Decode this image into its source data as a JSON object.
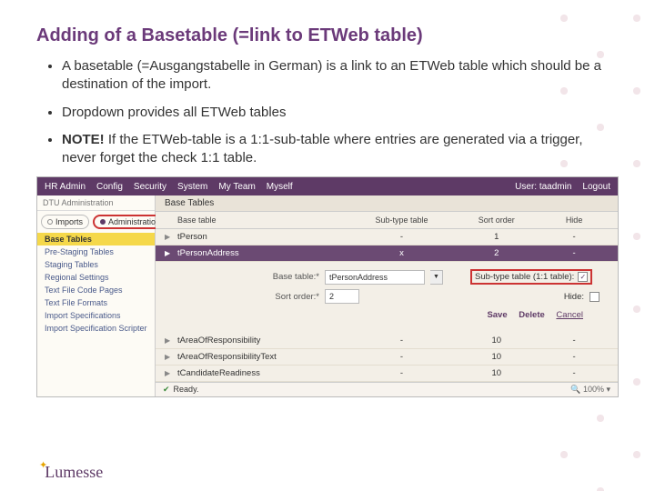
{
  "title": "Adding of a Basetable (=link to ETWeb table)",
  "bullets": {
    "b1": "A basetable (=Ausgangstabelle in German) is a link to an ETWeb table which should be a destination of the import.",
    "b2": "Dropdown provides all ETWeb tables",
    "b3_note": "NOTE!",
    "b3_rest": " If the ETWeb-table is a 1:1-sub-table where entries are generated via a trigger, never forget the check 1:1 table."
  },
  "menubar": {
    "items": [
      "HR Admin",
      "Config",
      "Security",
      "System",
      "My Team",
      "Myself"
    ],
    "user_label": "User: taadmin",
    "logout": "Logout"
  },
  "sidebar": {
    "header": "DTU Administration",
    "tab_imports": "Imports",
    "tab_admin": "Administration",
    "items": [
      "Base Tables",
      "Pre-Staging Tables",
      "Staging Tables",
      "Regional Settings",
      "Text File Code Pages",
      "Text File Formats",
      "Import Specifications",
      "Import Specification Scripter"
    ]
  },
  "maintable": {
    "title": "Base Tables",
    "headers": {
      "base": "Base table",
      "sub": "Sub-type table",
      "sort": "Sort order",
      "hide": "Hide"
    },
    "rows": [
      {
        "base": "tPerson",
        "sub": "-",
        "sort": "1",
        "hide": "-"
      },
      {
        "base": "tPersonAddress",
        "sub": "x",
        "sort": "2",
        "hide": "-"
      },
      {
        "base": "tAreaOfResponsibility",
        "sub": "-",
        "sort": "10",
        "hide": "-"
      },
      {
        "base": "tAreaOfResponsibilityText",
        "sub": "-",
        "sort": "10",
        "hide": "-"
      },
      {
        "base": "tCandidateReadiness",
        "sub": "-",
        "sort": "10",
        "hide": "-"
      }
    ]
  },
  "detail": {
    "basetable_label": "Base table:*",
    "basetable_value": "tPersonAddress",
    "sortorder_label": "Sort order:*",
    "sortorder_value": "2",
    "subtype_label": "Sub-type table (1:1 table):",
    "hide_label": "Hide:",
    "save": "Save",
    "delete": "Delete",
    "cancel": "Cancel"
  },
  "status": {
    "ready": "Ready.",
    "zoom": "100%"
  },
  "logo": "Lumesse"
}
